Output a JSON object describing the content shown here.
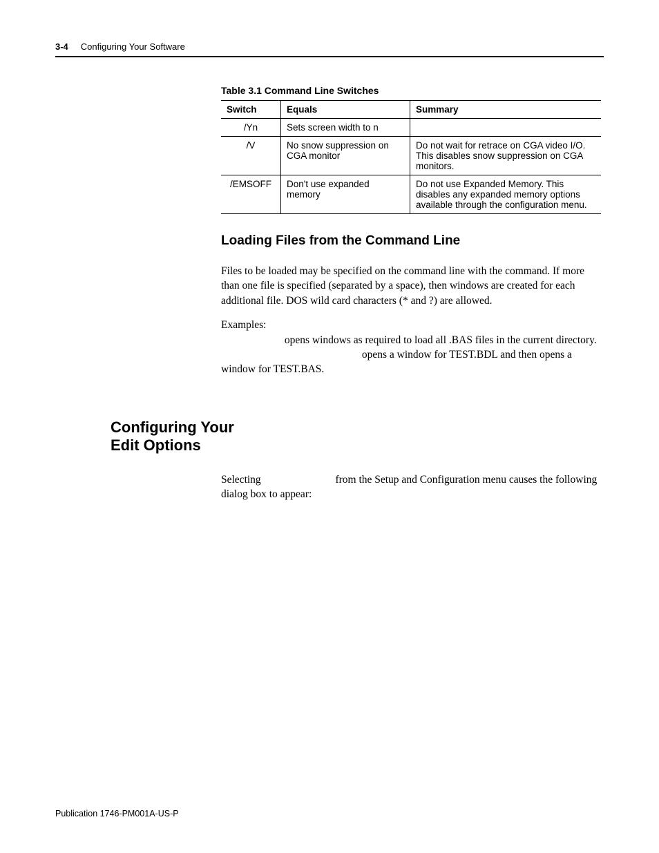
{
  "header": {
    "page_number": "3-4",
    "chapter_title": "Configuring Your Software"
  },
  "table": {
    "caption": "Table 3.1 Command Line Switches",
    "headers": {
      "c1": "Switch",
      "c2": "Equals",
      "c3": "Summary"
    },
    "rows": [
      {
        "c1": "/Yn",
        "c2": "Sets screen width to n",
        "c3": ""
      },
      {
        "c1": "/V",
        "c2": "No snow suppression on CGA monitor",
        "c3": "Do not wait for retrace on CGA video I/O. This disables snow suppression on CGA monitors."
      },
      {
        "c1": "/EMSOFF",
        "c2": "Don't use expanded memory",
        "c3": "Do not use Expanded Memory. This disables any expanded memory options available through the configuration menu."
      }
    ]
  },
  "section1": {
    "heading": "Loading Files from the Command Line",
    "para1": "Files to be loaded may be specified on the command line with the command. If more than one file is specified (separated by a space), then windows are created for each additional file. DOS wild card characters (* and ?) are allowed.",
    "examples_label": "Examples:",
    "ex1_tail": " opens windows as required to load all .BAS files in the current directory.",
    "ex2_tail": " opens a window for TEST.BDL and then opens a window for TEST.BAS."
  },
  "section2": {
    "side_heading": "Configuring Your Edit Options",
    "p_before": "Selecting ",
    "p_after": " from the Setup and Configuration menu causes the following dialog box to appear:"
  },
  "footer": {
    "pub": "Publication 1746-PM001A-US-P"
  }
}
